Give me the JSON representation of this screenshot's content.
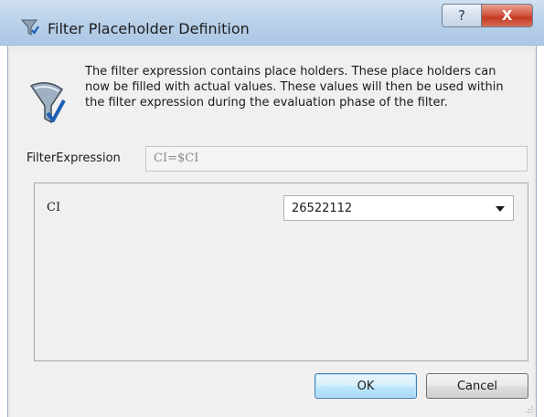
{
  "window": {
    "title": "Filter Placeholder Definition",
    "help_label": "?",
    "close_label": "X"
  },
  "description": "The filter expression contains place holders. These place holders can now be filled with actual values. These values will then be used within the filter expression during the evaluation phase of the filter.",
  "filter_expression": {
    "label": "FilterExpression",
    "value": "CI=$CI"
  },
  "parameters": [
    {
      "name": "CI",
      "value": "26522112"
    }
  ],
  "buttons": {
    "ok_label": "OK",
    "cancel_label": "Cancel"
  },
  "colors": {
    "titlebar": "#b7cfe8",
    "close_button": "#c33a22",
    "ok_border": "#3c7fb1"
  },
  "icons": {
    "title": "filter-funnel-icon",
    "description": "filter-funnel-check-icon",
    "dropdown": "chevron-down-icon"
  }
}
